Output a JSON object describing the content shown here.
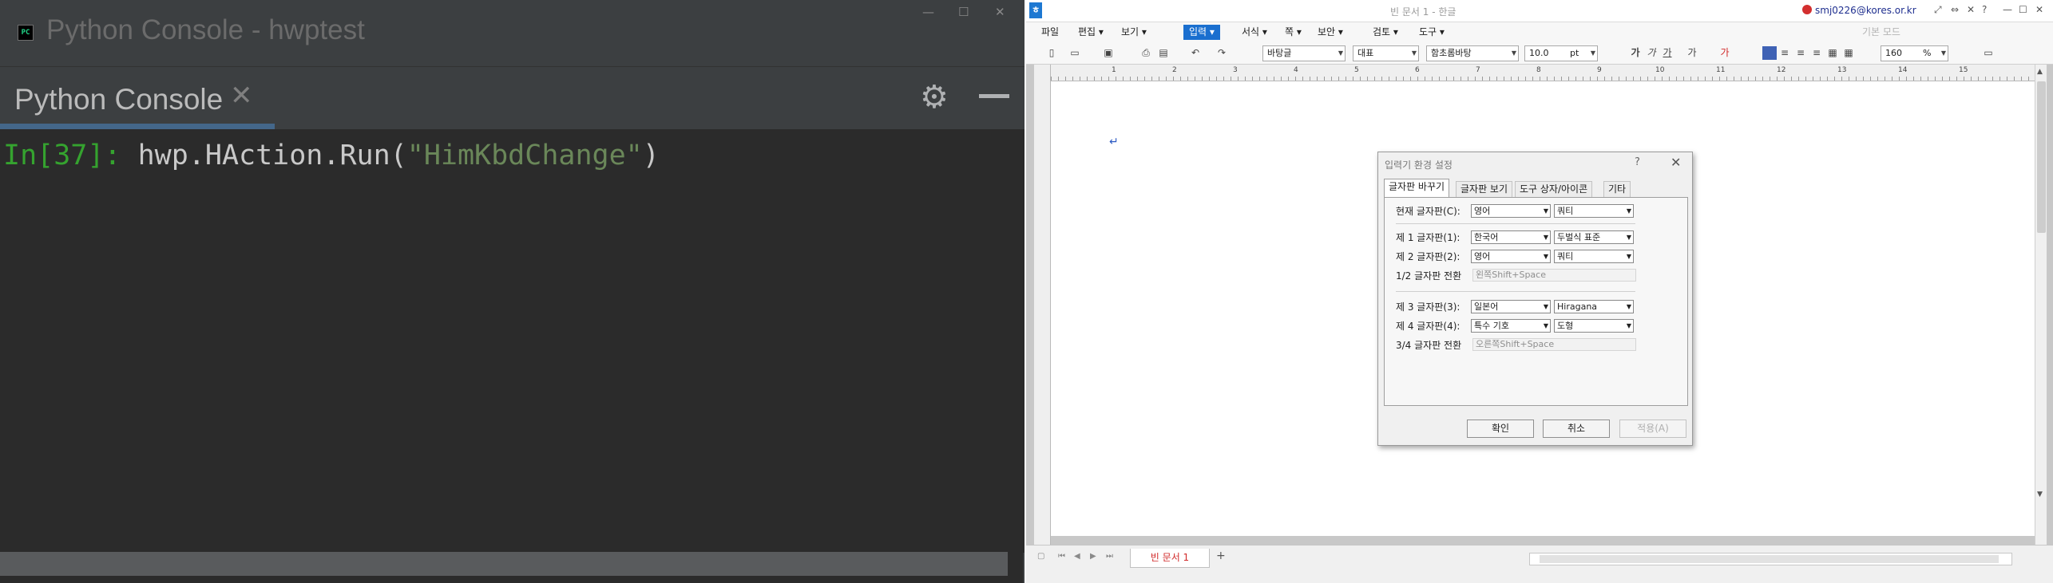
{
  "console_window": {
    "title": "Python Console - hwptest",
    "app_icon": "PC",
    "controls": [
      "—",
      "☐",
      "✕"
    ],
    "tab": {
      "label": "Python Console",
      "close": "✕"
    },
    "prompt": "In[37]:",
    "code_call": "hwp.HAction.Run(",
    "code_arg": "\"HimKbdChange\"",
    "code_close": ")"
  },
  "hwp_window": {
    "logo": "ㅎ",
    "doc_title": "빈 문서 1 - 한글",
    "account": "smj0226@kores.or.kr",
    "title_icons": [
      "⤢",
      "⇔",
      "✕",
      "?",
      "—",
      "☐",
      "✕"
    ],
    "menu": [
      {
        "label": "파일"
      },
      {
        "label": "편집 ▾"
      },
      {
        "label": "보기 ▾"
      },
      {
        "label": "입력 ▾",
        "active": true
      },
      {
        "label": "서식 ▾"
      },
      {
        "label": "쪽 ▾"
      },
      {
        "label": "보안 ▾"
      },
      {
        "label": "검토 ▾"
      },
      {
        "label": "도구 ▾"
      }
    ],
    "menu_right_hint": "기본 모드",
    "toolbar": {
      "style": "바탕글",
      "lang": "대표",
      "font": "함초롬바탕",
      "size": "10.0",
      "size_unit": "pt",
      "format_labels": [
        "가",
        "가",
        "가",
        "가",
        "가"
      ],
      "zoom": "160",
      "zoom_unit": "%"
    },
    "ruler_numbers": [
      "1",
      "2",
      "3",
      "4",
      "5",
      "6",
      "7",
      "8",
      "9",
      "10",
      "11",
      "12",
      "13",
      "14",
      "15"
    ],
    "paragraph_mark": "↵",
    "doc_tab": "빈 문서 1",
    "add_tab": "+"
  },
  "dialog": {
    "title": "입력기 환경 설정",
    "help": "?",
    "close": "✕",
    "tabs": [
      "글자판 바꾸기",
      "글자판 보기",
      "도구 상자/아이콘",
      "기타"
    ],
    "rows": [
      {
        "label": "현재 글자판(C):",
        "lang": "영어",
        "layout": "쿼티"
      },
      {
        "label": "제 1 글자판(1):",
        "lang": "한국어",
        "layout": "두벌식 표준"
      },
      {
        "label": "제 2 글자판(2):",
        "lang": "영어",
        "layout": "쿼티"
      },
      {
        "label": "제 3 글자판(3):",
        "lang": "일본어",
        "layout": "Hiragana"
      },
      {
        "label": "제 4 글자판(4):",
        "lang": "특수 기호",
        "layout": "도형"
      }
    ],
    "switch_12_label": "1/2 글자판 전환",
    "switch_12_value": "왼쪽Shift+Space",
    "switch_34_label": "3/4 글자판 전환",
    "switch_34_value": "오른쪽Shift+Space",
    "buttons": {
      "ok": "확인",
      "cancel": "취소",
      "apply": "적용(A)"
    }
  },
  "colors": {
    "accent": "#1a6fcf",
    "prompt": "#35a32f",
    "string": "#6a8759",
    "doc_tab": "#d12a2a"
  }
}
